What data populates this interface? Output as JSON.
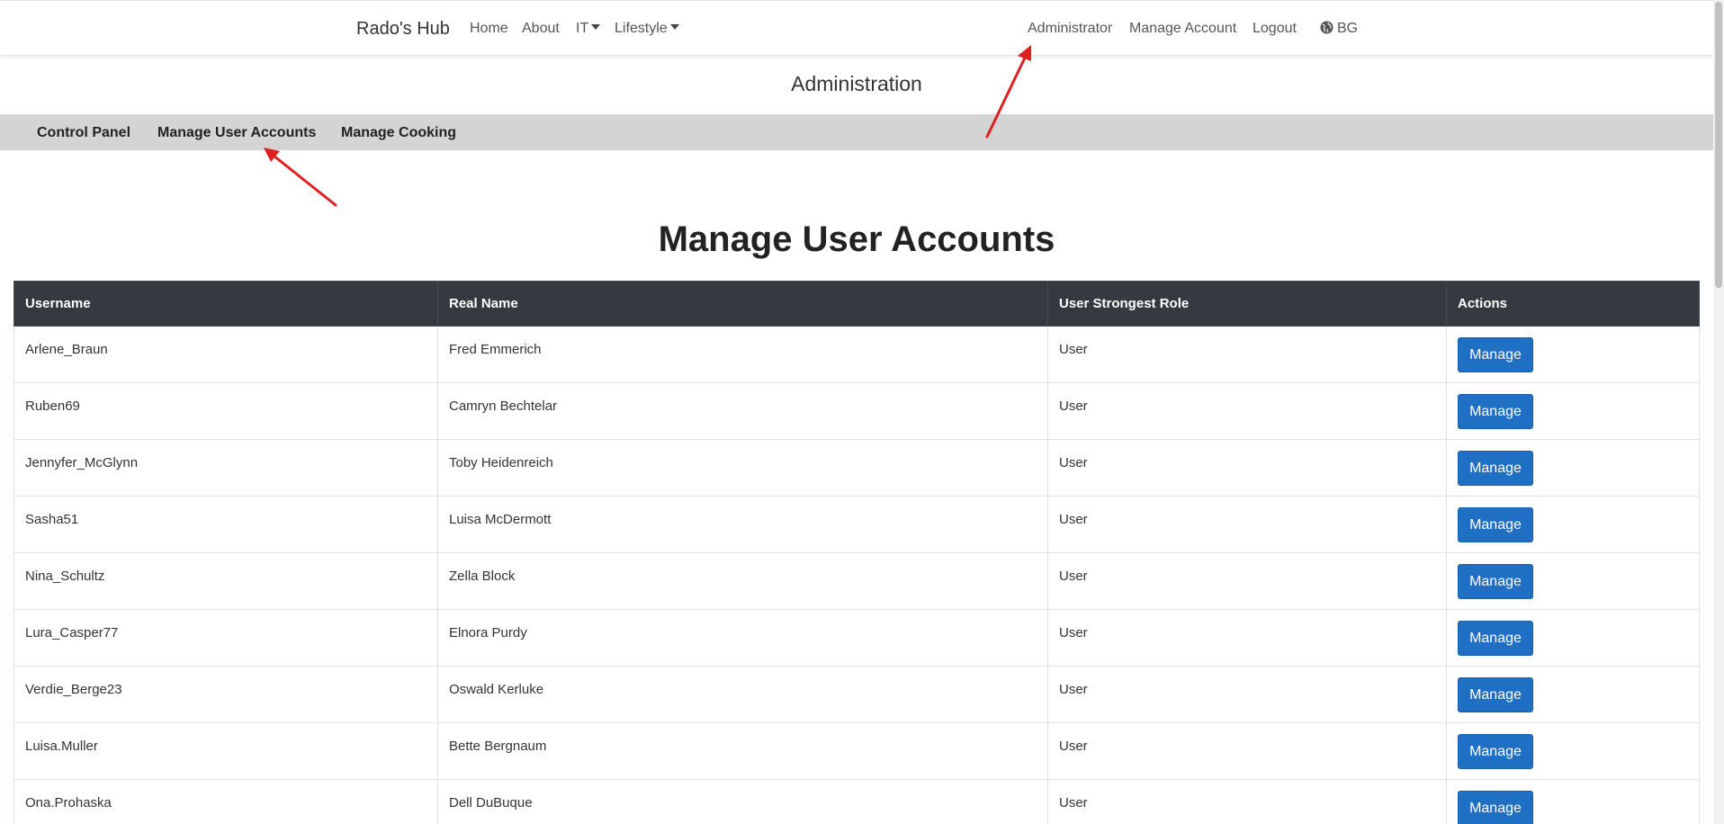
{
  "navbar": {
    "brand": "Rado's Hub",
    "links": {
      "home": "Home",
      "about": "About",
      "it": "IT",
      "lifestyle": "Lifestyle"
    },
    "right": {
      "administrator": "Administrator",
      "manage_account": "Manage Account",
      "logout": "Logout",
      "language": "BG"
    }
  },
  "admin": {
    "title": "Administration",
    "subnav": {
      "control_panel": "Control Panel",
      "manage_user_accounts": "Manage User Accounts",
      "manage_cooking": "Manage Cooking"
    }
  },
  "main": {
    "title": "Manage User Accounts",
    "columns": [
      "Username",
      "Real Name",
      "User Strongest Role",
      "Actions"
    ],
    "rows": [
      {
        "username": "Arlene_Braun",
        "real_name": "Fred Emmerich",
        "role": "User",
        "action": "Manage"
      },
      {
        "username": "Ruben69",
        "real_name": "Camryn Bechtelar",
        "role": "User",
        "action": "Manage"
      },
      {
        "username": "Jennyfer_McGlynn",
        "real_name": "Toby Heidenreich",
        "role": "User",
        "action": "Manage"
      },
      {
        "username": "Sasha51",
        "real_name": "Luisa McDermott",
        "role": "User",
        "action": "Manage"
      },
      {
        "username": "Nina_Schultz",
        "real_name": "Zella Block",
        "role": "User",
        "action": "Manage"
      },
      {
        "username": "Lura_Casper77",
        "real_name": "Elnora Purdy",
        "role": "User",
        "action": "Manage"
      },
      {
        "username": "Verdie_Berge23",
        "real_name": "Oswald Kerluke",
        "role": "User",
        "action": "Manage"
      },
      {
        "username": "Luisa.Muller",
        "real_name": "Bette Bergnaum",
        "role": "User",
        "action": "Manage"
      },
      {
        "username": "Ona.Prohaska",
        "real_name": "Dell DuBuque",
        "role": "User",
        "action": "Manage"
      }
    ]
  },
  "colors": {
    "navbar_bg": "#ffffff",
    "subnav_bg": "#d4d4d4",
    "table_header_bg": "#343a40",
    "button_bg": "#1f6fc5",
    "arrow": "#e02020"
  },
  "icons": {
    "language": "globe-icon",
    "dropdown": "caret-down-icon"
  }
}
